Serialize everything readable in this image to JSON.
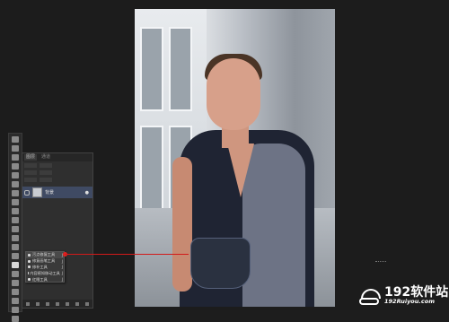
{
  "layers_panel": {
    "tabs": [
      "图层",
      "通道"
    ],
    "layer_name": "背景"
  },
  "tool_flyout": {
    "items": [
      {
        "label": "污点修复工具",
        "shortcut": "J"
      },
      {
        "label": "修复画笔工具",
        "shortcut": "J"
      },
      {
        "label": "修补工具",
        "shortcut": "J"
      },
      {
        "label": "内容感知移动工具",
        "shortcut": "J"
      },
      {
        "label": "红眼工具",
        "shortcut": "J"
      }
    ]
  },
  "annotation": {
    "line_color": "#d21a1a"
  },
  "watermark": {
    "title": "192软件站",
    "url": "192Ruiyou.com"
  }
}
